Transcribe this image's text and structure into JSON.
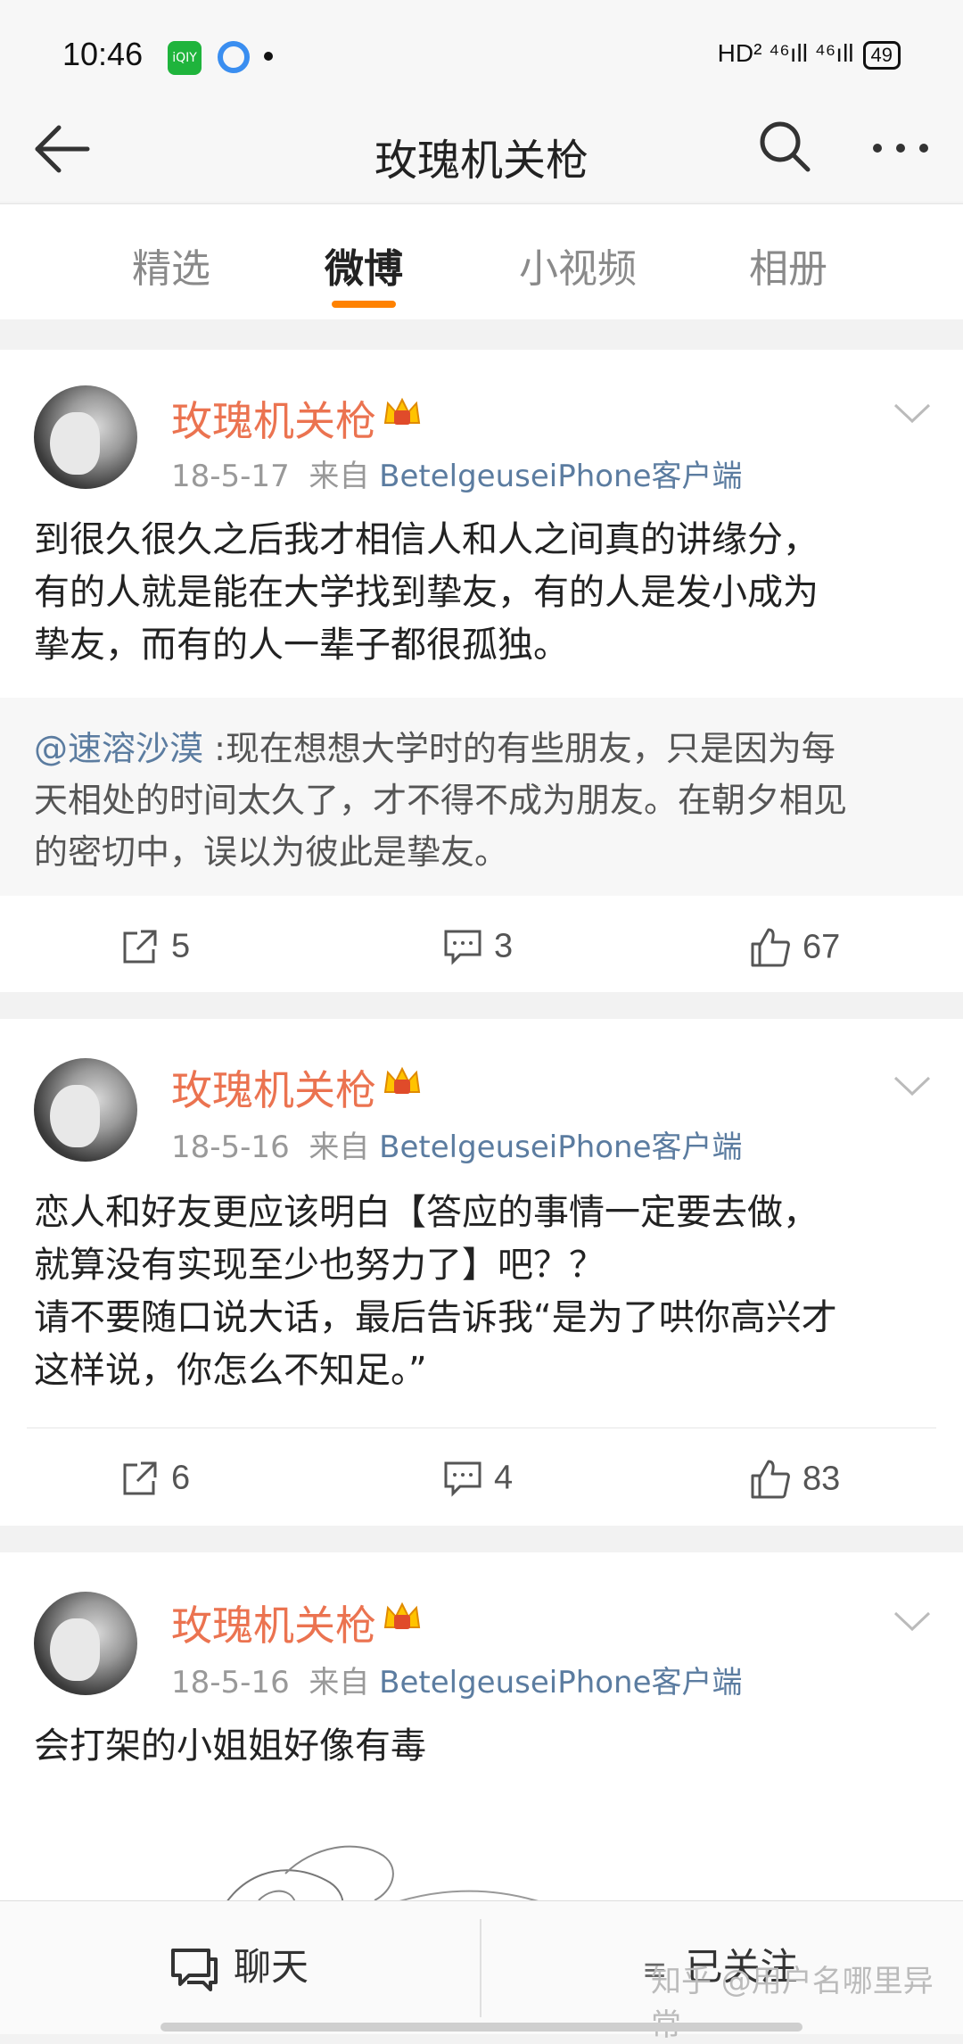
{
  "status_bar": {
    "time": "10:46",
    "right_text": "HD² ⁴⁶ıll ⁴⁶ıll",
    "battery": "49"
  },
  "nav": {
    "title": "玫瑰机关枪"
  },
  "tabs": [
    {
      "label": "精选",
      "active": false
    },
    {
      "label": "微博",
      "active": true
    },
    {
      "label": "小视频",
      "active": false
    },
    {
      "label": "相册",
      "active": false
    }
  ],
  "accent_color": "#ff8200",
  "posts": [
    {
      "username": "玫瑰机关枪",
      "date": "18-5-17",
      "from_prefix": "来自",
      "source": "BetelgeuseiPhone客户端",
      "text_lines": [
        "到很久很久之后我才相信人和人之间真的讲缘分，",
        "有的人就是能在大学找到挚友，有的人是发小成为",
        "挚友，而有的人一辈子都很孤独。"
      ],
      "repost": {
        "mention": "@速溶沙漠",
        "lines": [
          " :现在想想大学时的有些朋友，只是因为每",
          "天相处的时间太久了，才不得不成为朋友。在朝夕相见",
          "的密切中，误以为彼此是挚友。"
        ]
      },
      "reposts": "5",
      "comments": "3",
      "likes": "67"
    },
    {
      "username": "玫瑰机关枪",
      "date": "18-5-16",
      "from_prefix": "来自",
      "source": "BetelgeuseiPhone客户端",
      "text_lines": [
        "恋人和好友更应该明白【答应的事情一定要去做，",
        "就算没有实现至少也努力了】吧？？",
        "请不要随口说大话，最后告诉我“是为了哄你高兴才",
        "这样说，你怎么不知足。”"
      ],
      "reposts": "6",
      "comments": "4",
      "likes": "83"
    },
    {
      "username": "玫瑰机关枪",
      "date": "18-5-16",
      "from_prefix": "来自",
      "source": "BetelgeuseiPhone客户端",
      "text_lines": [
        "会打架的小姐姐好像有毒"
      ]
    }
  ],
  "bottom_bar": {
    "chat_label": "聊天",
    "follow_label": "已关注",
    "watermark": "知乎 @用户名哪里异常"
  }
}
